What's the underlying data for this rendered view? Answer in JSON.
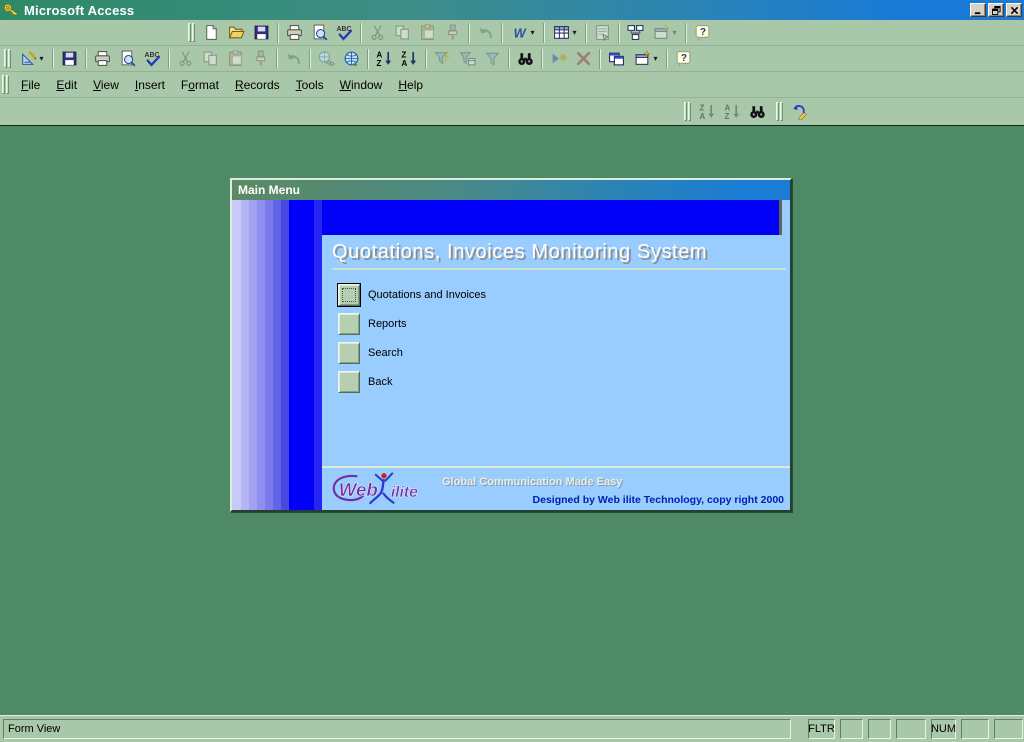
{
  "window": {
    "title": "Microsoft Access",
    "controls": [
      {
        "name": "minimize"
      },
      {
        "name": "restore"
      },
      {
        "name": "close"
      }
    ]
  },
  "menubar": {
    "items": [
      {
        "label": "File",
        "mnemonic_index": 0
      },
      {
        "label": "Edit",
        "mnemonic_index": 0
      },
      {
        "label": "View",
        "mnemonic_index": 0
      },
      {
        "label": "Insert",
        "mnemonic_index": 0
      },
      {
        "label": "Format",
        "mnemonic_index": 1
      },
      {
        "label": "Records",
        "mnemonic_index": 0
      },
      {
        "label": "Tools",
        "mnemonic_index": 0
      },
      {
        "label": "Window",
        "mnemonic_index": 0
      },
      {
        "label": "Help",
        "mnemonic_index": 0
      }
    ]
  },
  "toolbars": {
    "main": [
      {
        "t": "grip"
      },
      {
        "t": "new"
      },
      {
        "t": "open"
      },
      {
        "t": "save"
      },
      {
        "t": "sep"
      },
      {
        "t": "print"
      },
      {
        "t": "print-preview"
      },
      {
        "t": "spelling"
      },
      {
        "t": "sep"
      },
      {
        "t": "cut",
        "d": true
      },
      {
        "t": "copy",
        "d": true
      },
      {
        "t": "paste",
        "d": true
      },
      {
        "t": "format-painter",
        "d": true
      },
      {
        "t": "sep"
      },
      {
        "t": "undo",
        "d": true
      },
      {
        "t": "sep"
      },
      {
        "t": "office-links",
        "dd": true
      },
      {
        "t": "sep"
      },
      {
        "t": "analyze",
        "dd": true
      },
      {
        "t": "sep"
      },
      {
        "t": "properties",
        "d": true
      },
      {
        "t": "sep"
      },
      {
        "t": "relationships"
      },
      {
        "t": "new-object",
        "dd": true,
        "d": true
      },
      {
        "t": "sep"
      },
      {
        "t": "help"
      }
    ],
    "form_view": [
      {
        "t": "grip"
      },
      {
        "t": "view",
        "dd": true
      },
      {
        "t": "sep"
      },
      {
        "t": "save"
      },
      {
        "t": "sep"
      },
      {
        "t": "print"
      },
      {
        "t": "print-preview"
      },
      {
        "t": "spelling"
      },
      {
        "t": "sep"
      },
      {
        "t": "cut",
        "d": true
      },
      {
        "t": "copy",
        "d": true
      },
      {
        "t": "paste",
        "d": true
      },
      {
        "t": "format-painter",
        "d": true
      },
      {
        "t": "sep"
      },
      {
        "t": "undo",
        "d": true
      },
      {
        "t": "sep"
      },
      {
        "t": "insert-hyperlink",
        "d": true
      },
      {
        "t": "web"
      },
      {
        "t": "sep"
      },
      {
        "t": "sort-ascending"
      },
      {
        "t": "sort-descending"
      },
      {
        "t": "sep"
      },
      {
        "t": "filter-by-selection",
        "d": true
      },
      {
        "t": "filter-by-form",
        "d": true
      },
      {
        "t": "apply-filter",
        "d": true
      },
      {
        "t": "sep"
      },
      {
        "t": "find"
      },
      {
        "t": "sep"
      },
      {
        "t": "new-record",
        "d": true
      },
      {
        "t": "delete-record",
        "d": true
      },
      {
        "t": "sep"
      },
      {
        "t": "database-window"
      },
      {
        "t": "new-object",
        "dd": true
      },
      {
        "t": "sep"
      },
      {
        "t": "help"
      }
    ],
    "float_sort_find": [
      {
        "t": "grip"
      },
      {
        "t": "sort-descending",
        "d": true
      },
      {
        "t": "sort-ascending",
        "d": true
      },
      {
        "t": "find"
      }
    ],
    "float_undo": [
      {
        "t": "grip"
      },
      {
        "t": "undo-formatting"
      }
    ]
  },
  "form": {
    "title": "Main Menu",
    "heading": "Quotations, Invoices Monitoring System",
    "buttons": [
      {
        "label": "Quotations and Invoices",
        "focused": true
      },
      {
        "label": "Reports",
        "focused": false
      },
      {
        "label": "Search",
        "focused": false
      },
      {
        "label": "Back",
        "focused": false
      }
    ],
    "footer": {
      "logo": {
        "word1": "Web",
        "word2": "ilite"
      },
      "tagline": "Global Communication Made Easy",
      "credit": "Designed by Web ilite Technology, copy right 2000"
    }
  },
  "statusbar": {
    "message": "Form View",
    "panels": [
      "FLTR",
      "",
      "",
      "",
      "NUM",
      "",
      ""
    ]
  },
  "colors": {
    "desktop": "#4f8a66",
    "chrome": "#a9c7a9",
    "form_body": "#99ccff",
    "accent_blue": "#0000f6",
    "title_green": "#2e8a66",
    "title_blue": "#187ad6",
    "credit_navy": "#0020b0",
    "logo_purple": "#7030a0"
  }
}
